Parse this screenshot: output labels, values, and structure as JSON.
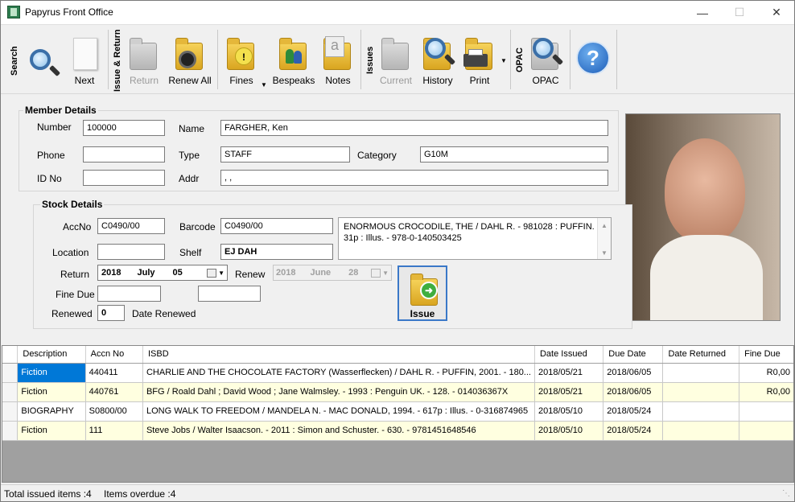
{
  "window": {
    "title": "Papyrus Front Office"
  },
  "toolbar": {
    "groups": {
      "search": "Search",
      "issue_return": "Issue & Return",
      "issues": "Issues",
      "opac": "OPAC"
    },
    "buttons": {
      "next": "Next",
      "return": "Return",
      "renew_all": "Renew All",
      "fines": "Fines",
      "bespeaks": "Bespeaks",
      "notes": "Notes",
      "current": "Current",
      "history": "History",
      "print": "Print",
      "opac": "OPAC"
    }
  },
  "member": {
    "title": "Member Details",
    "labels": {
      "number": "Number",
      "name": "Name",
      "phone": "Phone",
      "type": "Type",
      "category": "Category",
      "id_no": "ID No",
      "addr": "Addr"
    },
    "values": {
      "number": "100000",
      "name": "FARGHER, Ken",
      "phone": "",
      "type": "STAFF",
      "category": "G10M",
      "id_no": "",
      "addr": ", ,"
    }
  },
  "stock": {
    "title": "Stock Details",
    "labels": {
      "accno": "AccNo",
      "barcode": "Barcode",
      "location": "Location",
      "shelf": "Shelf",
      "return": "Return",
      "renew": "Renew",
      "fine_due": "Fine Due",
      "renewed": "Renewed",
      "date_renewed": "Date Renewed"
    },
    "values": {
      "accno": "C0490/00",
      "barcode": "C0490/00",
      "location": "",
      "shelf": "EJ DAH",
      "description": "ENORMOUS CROCODILE, THE / DAHL R. - 981028 : PUFFIN. - 31p : Illus. - 978-0-140503425",
      "return_date": {
        "year": "2018",
        "month": "July",
        "day": "05"
      },
      "renew_date": {
        "year": "2018",
        "month": "June",
        "day": "28"
      },
      "fine_due": "",
      "renewed": "0",
      "date_renewed": ""
    },
    "issue_button": "Issue"
  },
  "grid": {
    "columns": [
      "Description",
      "Accn No",
      "ISBD",
      "Date Issued",
      "Due Date",
      "Date Returned",
      "Fine Due"
    ],
    "rows": [
      [
        "Fiction",
        "440411",
        "CHARLIE AND THE CHOCOLATE FACTORY (Wasserflecken) / DAHL R. - PUFFIN, 2001. - 180...",
        "2018/05/21",
        "2018/06/05",
        "",
        "R0,00"
      ],
      [
        "Fiction",
        "440761",
        "BFG / Roald Dahl ; David Wood ; Jane Walmsley. - 1993 : Penguin UK. - 128. - 014036367X",
        "2018/05/21",
        "2018/06/05",
        "",
        "R0,00"
      ],
      [
        "BIOGRAPHY",
        "S0800/00",
        "LONG WALK TO FREEDOM / MANDELA N. - MAC DONALD, 1994. - 617p : Illus. - 0-316874965",
        "2018/05/10",
        "2018/05/24",
        "",
        ""
      ],
      [
        "Fiction",
        "111",
        "Steve Jobs / Walter Isaacson. - 2011 : Simon and Schuster. - 630. - 9781451648546",
        "2018/05/10",
        "2018/05/24",
        "",
        ""
      ]
    ]
  },
  "status": {
    "total": "Total issued items :4",
    "overdue": "Items overdue :4"
  },
  "icons": [
    "app-icon",
    "search-icon",
    "next-icon",
    "return-icon",
    "renew-all-icon",
    "fines-icon",
    "bespeaks-icon",
    "notes-icon",
    "current-icon",
    "history-icon",
    "print-icon",
    "opac-icon",
    "help-icon",
    "calendar-icon",
    "issue-icon"
  ]
}
